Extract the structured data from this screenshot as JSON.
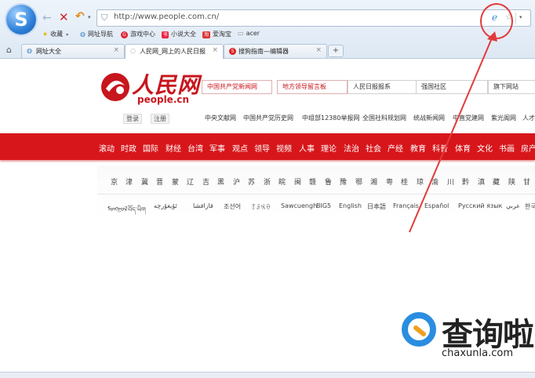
{
  "browser": {
    "logo_letter": "S",
    "back_glyph": "←",
    "stop_glyph": "✕",
    "undo_glyph": "↶",
    "caret": "▾",
    "address_url": "http://www.people.com.cn/",
    "bookmarks": [
      {
        "icon": "star-icon",
        "glyph": "★",
        "label": "收藏"
      },
      {
        "icon": "globe-icon",
        "glyph": "◍",
        "label": "网址导航"
      },
      {
        "icon": "game-icon",
        "glyph": "G",
        "label": "游戏中心"
      },
      {
        "icon": "book-icon",
        "glyph": "书",
        "label": "小说大全"
      },
      {
        "icon": "taobao-icon",
        "glyph": "淘",
        "label": "爱淘宝"
      },
      {
        "icon": "folder-icon",
        "glyph": "▭",
        "label": "acer"
      }
    ],
    "tabs": [
      {
        "label": "网址大全",
        "active": false
      },
      {
        "label": "人民网_网上的人民日报",
        "active": true
      },
      {
        "label": "搜狗指南—编辑器",
        "active": false
      }
    ],
    "tab_close": "×",
    "new_tab": "+"
  },
  "site": {
    "title": "人民网",
    "subtitle": "people.cn",
    "top_links": [
      "中国共产党新闻网",
      "地方领导留言板",
      "人民日报报系",
      "强国社区",
      "旗下网站"
    ],
    "login_label": "登录",
    "register_label": "注册",
    "sister_sites": [
      "中央文献网",
      "中国共产党历史网",
      "中组部12380举报网",
      "全国社科规划网",
      "统战新闻网",
      "中直党建网",
      "紫光阁网",
      "人才"
    ],
    "channels": [
      "滚动",
      "时政",
      "国际",
      "财经",
      "台湾",
      "军事",
      "观点",
      "领导",
      "视频",
      "人事",
      "理论",
      "法治",
      "社会",
      "产经",
      "教育",
      "科普",
      "体育",
      "文化",
      "书画",
      "房产"
    ],
    "provinces": [
      "京",
      "津",
      "冀",
      "晋",
      "蒙",
      "辽",
      "吉",
      "黑",
      "沪",
      "苏",
      "浙",
      "皖",
      "闽",
      "赣",
      "鲁",
      "豫",
      "鄂",
      "湘",
      "粤",
      "桂",
      "琼",
      "渝",
      "川",
      "黔",
      "滇",
      "藏",
      "陕",
      "甘"
    ],
    "languages": [
      "ᠮᠣᠩᠭᠣᠯ",
      "བོད་ཡིག",
      "ئۇيغۇرچە",
      "قازاقشا",
      "조선어",
      "ꆈꌠꁱꂷ",
      "Sawcuengh",
      "BIG5",
      "English",
      "日本語",
      "Français",
      "Español",
      "Русский язык",
      "عربي",
      "한국어"
    ]
  },
  "watermark": {
    "text": "查询啦",
    "domain": "chaxunla.com"
  },
  "colors": {
    "brand_red": "#d7161b",
    "annotation_red": "#e23a3a",
    "chrome_blue": "#2d7fd8"
  }
}
